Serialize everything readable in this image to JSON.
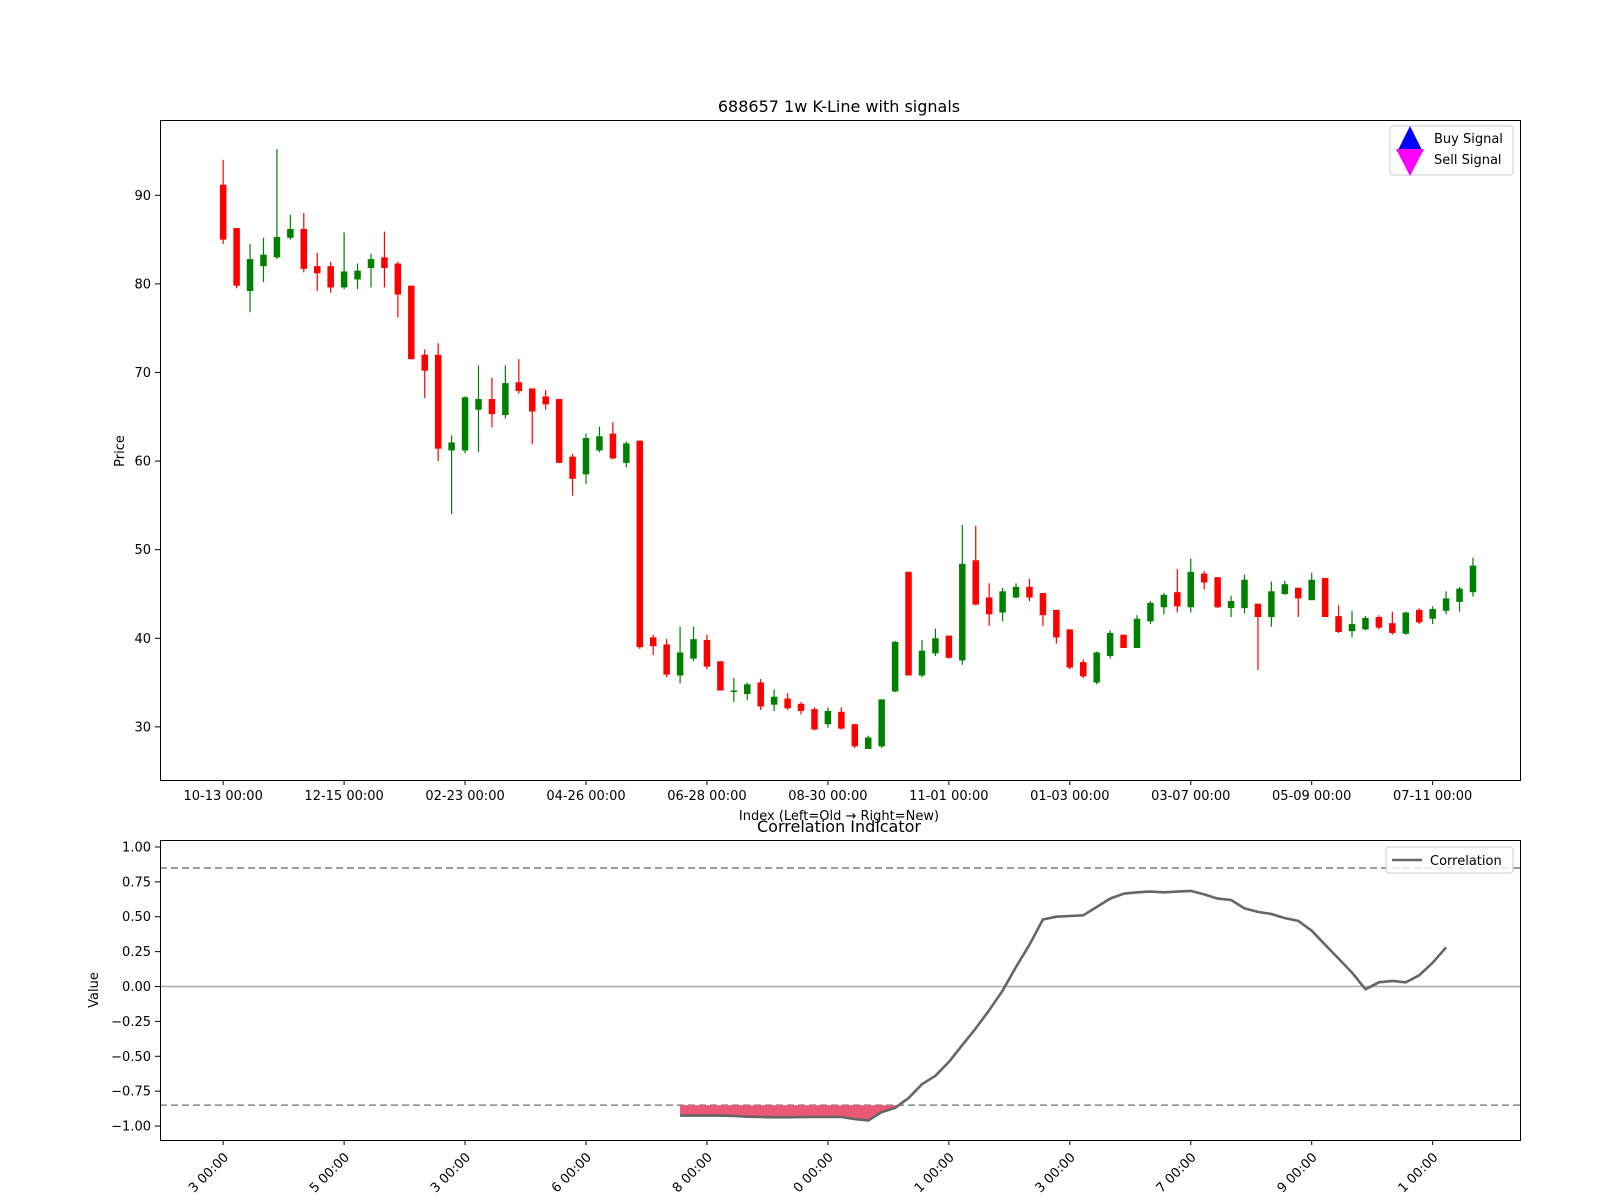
{
  "chart_data": [
    {
      "type": "candlestick",
      "title": "688657 1w K-Line with signals",
      "xlabel": "Index (Left=Old → Right=New)",
      "ylabel": "Price",
      "ylim": [
        24,
        98.5
      ],
      "yticks": [
        30,
        40,
        50,
        60,
        70,
        80,
        90
      ],
      "xlim": [
        -4.7,
        96.5
      ],
      "xticks": [
        {
          "index": 0,
          "label": "10-13 00:00"
        },
        {
          "index": 9,
          "label": "12-15 00:00"
        },
        {
          "index": 18,
          "label": "02-23 00:00"
        },
        {
          "index": 27,
          "label": "04-26 00:00"
        },
        {
          "index": 36,
          "label": "06-28 00:00"
        },
        {
          "index": 45,
          "label": "08-30 00:00"
        },
        {
          "index": 54,
          "label": "11-01 00:00"
        },
        {
          "index": 63,
          "label": "01-03 00:00"
        },
        {
          "index": 72,
          "label": "03-07 00:00"
        },
        {
          "index": 81,
          "label": "05-09 00:00"
        },
        {
          "index": 90,
          "label": "07-11 00:00"
        }
      ],
      "up_color": "#008000",
      "down_color": "#ff0000",
      "legend": {
        "position": "top-right",
        "entries": [
          {
            "label": "Buy Signal",
            "marker": "triangle-up",
            "color": "#0000ff"
          },
          {
            "label": "Sell Signal",
            "marker": "triangle-down",
            "color": "#ff00ff"
          }
        ]
      },
      "candles": [
        {
          "o": 91.2,
          "h": 94.0,
          "l": 84.5,
          "c": 85.0
        },
        {
          "o": 86.3,
          "h": 86.3,
          "l": 79.5,
          "c": 79.8
        },
        {
          "o": 79.2,
          "h": 84.5,
          "l": 76.8,
          "c": 82.8
        },
        {
          "o": 82.0,
          "h": 85.2,
          "l": 80.2,
          "c": 83.3
        },
        {
          "o": 83.0,
          "h": 95.2,
          "l": 82.8,
          "c": 85.3
        },
        {
          "o": 85.2,
          "h": 87.8,
          "l": 85.0,
          "c": 86.2
        },
        {
          "o": 86.2,
          "h": 88.0,
          "l": 81.3,
          "c": 81.7
        },
        {
          "o": 82.0,
          "h": 83.5,
          "l": 79.2,
          "c": 81.2
        },
        {
          "o": 82.0,
          "h": 82.5,
          "l": 79.0,
          "c": 79.6
        },
        {
          "o": 79.6,
          "h": 85.8,
          "l": 79.4,
          "c": 81.4
        },
        {
          "o": 80.5,
          "h": 82.3,
          "l": 79.4,
          "c": 81.5
        },
        {
          "o": 81.8,
          "h": 83.4,
          "l": 79.6,
          "c": 82.8
        },
        {
          "o": 83.0,
          "h": 85.9,
          "l": 79.6,
          "c": 81.8
        },
        {
          "o": 82.3,
          "h": 82.5,
          "l": 76.2,
          "c": 78.8
        },
        {
          "o": 79.8,
          "h": 79.8,
          "l": 71.5,
          "c": 71.5
        },
        {
          "o": 72.0,
          "h": 72.6,
          "l": 67.1,
          "c": 70.2
        },
        {
          "o": 72.0,
          "h": 73.3,
          "l": 60.0,
          "c": 61.4
        },
        {
          "o": 61.2,
          "h": 62.9,
          "l": 54.0,
          "c": 62.1
        },
        {
          "o": 61.2,
          "h": 67.3,
          "l": 60.9,
          "c": 67.2
        },
        {
          "o": 65.8,
          "h": 70.8,
          "l": 61.0,
          "c": 67.0
        },
        {
          "o": 67.0,
          "h": 69.4,
          "l": 63.8,
          "c": 65.3
        },
        {
          "o": 65.2,
          "h": 70.8,
          "l": 64.8,
          "c": 68.8
        },
        {
          "o": 68.9,
          "h": 71.5,
          "l": 67.6,
          "c": 67.9
        },
        {
          "o": 68.2,
          "h": 68.2,
          "l": 61.9,
          "c": 65.6
        },
        {
          "o": 67.3,
          "h": 68.0,
          "l": 65.8,
          "c": 66.4
        },
        {
          "o": 67.0,
          "h": 67.0,
          "l": 59.8,
          "c": 59.8
        },
        {
          "o": 60.5,
          "h": 60.8,
          "l": 56.1,
          "c": 58.0
        },
        {
          "o": 58.5,
          "h": 63.1,
          "l": 57.4,
          "c": 62.6
        },
        {
          "o": 61.2,
          "h": 63.9,
          "l": 61.0,
          "c": 62.8
        },
        {
          "o": 63.1,
          "h": 64.4,
          "l": 60.2,
          "c": 60.3
        },
        {
          "o": 59.8,
          "h": 62.2,
          "l": 59.3,
          "c": 62.0
        },
        {
          "o": 62.3,
          "h": 62.3,
          "l": 38.8,
          "c": 39.0
        },
        {
          "o": 40.1,
          "h": 40.4,
          "l": 38.1,
          "c": 39.1
        },
        {
          "o": 39.3,
          "h": 39.9,
          "l": 35.6,
          "c": 35.9
        },
        {
          "o": 35.8,
          "h": 41.3,
          "l": 34.9,
          "c": 38.4
        },
        {
          "o": 37.7,
          "h": 41.3,
          "l": 37.4,
          "c": 39.9
        },
        {
          "o": 39.8,
          "h": 40.4,
          "l": 36.5,
          "c": 36.8
        },
        {
          "o": 37.4,
          "h": 37.4,
          "l": 34.1,
          "c": 34.1
        },
        {
          "o": 34.1,
          "h": 35.5,
          "l": 32.8,
          "c": 34.1
        },
        {
          "o": 33.7,
          "h": 35.0,
          "l": 33.0,
          "c": 34.8
        },
        {
          "o": 35.0,
          "h": 35.4,
          "l": 31.9,
          "c": 32.3
        },
        {
          "o": 32.5,
          "h": 34.2,
          "l": 31.8,
          "c": 33.4
        },
        {
          "o": 33.2,
          "h": 33.8,
          "l": 31.9,
          "c": 32.1
        },
        {
          "o": 32.6,
          "h": 32.8,
          "l": 31.4,
          "c": 31.8
        },
        {
          "o": 32.0,
          "h": 32.2,
          "l": 29.6,
          "c": 29.7
        },
        {
          "o": 30.3,
          "h": 32.2,
          "l": 29.9,
          "c": 31.8
        },
        {
          "o": 31.7,
          "h": 32.2,
          "l": 29.7,
          "c": 29.8
        },
        {
          "o": 30.3,
          "h": 30.3,
          "l": 27.6,
          "c": 27.8
        },
        {
          "o": 27.5,
          "h": 29.0,
          "l": 27.5,
          "c": 28.8
        },
        {
          "o": 27.8,
          "h": 33.1,
          "l": 27.6,
          "c": 33.1
        },
        {
          "o": 34.0,
          "h": 39.7,
          "l": 33.9,
          "c": 39.6
        },
        {
          "o": 47.5,
          "h": 47.5,
          "l": 35.8,
          "c": 35.8
        },
        {
          "o": 35.8,
          "h": 39.8,
          "l": 35.6,
          "c": 38.6
        },
        {
          "o": 38.3,
          "h": 41.1,
          "l": 38.0,
          "c": 40.0
        },
        {
          "o": 40.3,
          "h": 40.3,
          "l": 37.7,
          "c": 37.8
        },
        {
          "o": 37.5,
          "h": 52.8,
          "l": 37.0,
          "c": 48.4
        },
        {
          "o": 48.8,
          "h": 52.7,
          "l": 43.7,
          "c": 43.8
        },
        {
          "o": 44.6,
          "h": 46.2,
          "l": 41.4,
          "c": 42.7
        },
        {
          "o": 42.9,
          "h": 45.7,
          "l": 41.9,
          "c": 45.3
        },
        {
          "o": 44.6,
          "h": 46.2,
          "l": 44.5,
          "c": 45.8
        },
        {
          "o": 45.8,
          "h": 46.7,
          "l": 44.2,
          "c": 44.6
        },
        {
          "o": 45.1,
          "h": 45.1,
          "l": 41.4,
          "c": 42.6
        },
        {
          "o": 43.2,
          "h": 43.2,
          "l": 39.4,
          "c": 40.1
        },
        {
          "o": 41.0,
          "h": 41.0,
          "l": 36.5,
          "c": 36.7
        },
        {
          "o": 37.3,
          "h": 37.6,
          "l": 35.5,
          "c": 35.7
        },
        {
          "o": 35.0,
          "h": 38.5,
          "l": 34.8,
          "c": 38.4
        },
        {
          "o": 38.0,
          "h": 40.9,
          "l": 37.7,
          "c": 40.6
        },
        {
          "o": 40.4,
          "h": 40.4,
          "l": 38.9,
          "c": 38.9
        },
        {
          "o": 38.9,
          "h": 42.6,
          "l": 38.9,
          "c": 42.2
        },
        {
          "o": 41.9,
          "h": 44.2,
          "l": 41.6,
          "c": 44.0
        },
        {
          "o": 43.5,
          "h": 45.1,
          "l": 42.7,
          "c": 44.9
        },
        {
          "o": 45.2,
          "h": 47.8,
          "l": 42.9,
          "c": 43.6
        },
        {
          "o": 43.5,
          "h": 49.0,
          "l": 42.9,
          "c": 47.5
        },
        {
          "o": 47.3,
          "h": 47.6,
          "l": 45.5,
          "c": 46.3
        },
        {
          "o": 46.9,
          "h": 46.9,
          "l": 43.4,
          "c": 43.5
        },
        {
          "o": 43.4,
          "h": 44.8,
          "l": 42.4,
          "c": 44.2
        },
        {
          "o": 43.4,
          "h": 47.2,
          "l": 42.8,
          "c": 46.6
        },
        {
          "o": 43.9,
          "h": 43.9,
          "l": 36.4,
          "c": 42.4
        },
        {
          "o": 42.4,
          "h": 46.4,
          "l": 41.3,
          "c": 45.3
        },
        {
          "o": 45.0,
          "h": 46.5,
          "l": 44.9,
          "c": 46.1
        },
        {
          "o": 45.7,
          "h": 45.7,
          "l": 42.4,
          "c": 44.5
        },
        {
          "o": 44.3,
          "h": 47.4,
          "l": 44.3,
          "c": 46.6
        },
        {
          "o": 46.8,
          "h": 46.8,
          "l": 42.4,
          "c": 42.4
        },
        {
          "o": 42.5,
          "h": 43.7,
          "l": 40.6,
          "c": 40.7
        },
        {
          "o": 40.8,
          "h": 43.1,
          "l": 40.1,
          "c": 41.6
        },
        {
          "o": 41.0,
          "h": 42.5,
          "l": 40.9,
          "c": 42.3
        },
        {
          "o": 42.4,
          "h": 42.6,
          "l": 41.0,
          "c": 41.2
        },
        {
          "o": 41.7,
          "h": 43.0,
          "l": 40.4,
          "c": 40.6
        },
        {
          "o": 40.5,
          "h": 43.0,
          "l": 40.4,
          "c": 42.9
        },
        {
          "o": 43.2,
          "h": 43.4,
          "l": 41.6,
          "c": 41.8
        },
        {
          "o": 42.2,
          "h": 43.6,
          "l": 41.6,
          "c": 43.3
        },
        {
          "o": 43.1,
          "h": 45.3,
          "l": 42.7,
          "c": 44.5
        },
        {
          "o": 44.1,
          "h": 45.8,
          "l": 43.0,
          "c": 45.6
        },
        {
          "o": 45.2,
          "h": 49.1,
          "l": 44.7,
          "c": 48.2
        }
      ]
    },
    {
      "type": "line",
      "title": "Correlation Indicator",
      "ylabel": "Value",
      "ylim": [
        -1.1,
        1.05
      ],
      "yticks": [
        -1.0,
        -0.75,
        -0.5,
        -0.25,
        0.0,
        0.25,
        0.5,
        0.75,
        1.0
      ],
      "ytick_labels": [
        "−1.00",
        "−0.75",
        "−0.50",
        "−0.25",
        "0.00",
        "0.25",
        "0.50",
        "0.75",
        "1.00"
      ],
      "xlim": [
        -4.7,
        96.5
      ],
      "xticks": [
        {
          "index": 0,
          "label": "3 00:00"
        },
        {
          "index": 9,
          "label": "5 00:00"
        },
        {
          "index": 18,
          "label": "3 00:00"
        },
        {
          "index": 27,
          "label": "6 00:00"
        },
        {
          "index": 36,
          "label": "8 00:00"
        },
        {
          "index": 45,
          "label": "0 00:00"
        },
        {
          "index": 54,
          "label": "1 00:00"
        },
        {
          "index": 63,
          "label": "3 00:00"
        },
        {
          "index": 72,
          "label": "7 00:00"
        },
        {
          "index": 81,
          "label": "9 00:00"
        },
        {
          "index": 90,
          "label": "1 00:00"
        }
      ],
      "thresholds": [
        0.85,
        -0.85
      ],
      "zero_line": 0.0,
      "fill_color": "#e8506e",
      "line_color": "#666666",
      "legend": {
        "position": "top-right",
        "entries": [
          {
            "label": "Correlation",
            "color": "#666666"
          }
        ]
      },
      "series": [
        {
          "name": "Correlation",
          "start_index": 34,
          "values": [
            -0.925,
            -0.925,
            -0.925,
            -0.925,
            -0.928,
            -0.933,
            -0.935,
            -0.937,
            -0.937,
            -0.936,
            -0.935,
            -0.935,
            -0.935,
            -0.95,
            -0.96,
            -0.9,
            -0.87,
            -0.8,
            -0.7,
            -0.64,
            -0.54,
            -0.42,
            -0.3,
            -0.17,
            -0.03,
            0.14,
            0.3,
            0.48,
            0.5,
            0.505,
            0.51,
            0.57,
            0.63,
            0.665,
            0.675,
            0.68,
            0.675,
            0.68,
            0.685,
            0.66,
            0.63,
            0.62,
            0.56,
            0.535,
            0.52,
            0.49,
            0.47,
            0.4,
            0.3,
            0.2,
            0.1,
            -0.02,
            0.03,
            0.04,
            0.03,
            0.08,
            0.17,
            0.28
          ]
        }
      ]
    }
  ]
}
